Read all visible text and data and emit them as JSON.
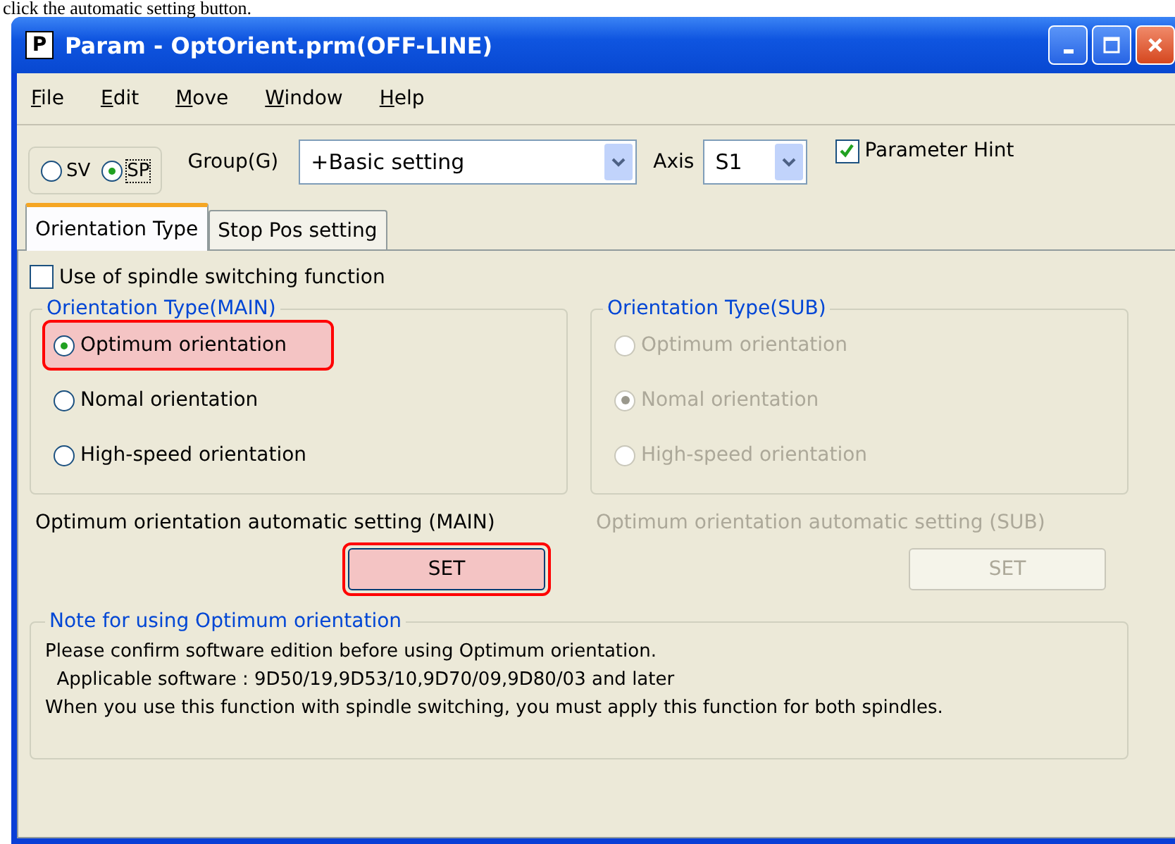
{
  "caption": "click the automatic setting button.",
  "window": {
    "icon": "P",
    "title": "Param - OptOrient.prm(OFF-LINE)"
  },
  "menu": [
    {
      "label": "File"
    },
    {
      "label": "Edit"
    },
    {
      "label": "Move"
    },
    {
      "label": "Window"
    },
    {
      "label": "Help"
    }
  ],
  "mode": [
    {
      "label": "SV",
      "selected": false
    },
    {
      "label": "SP",
      "selected": true
    }
  ],
  "group": {
    "label": "Group(G)",
    "value": "+Basic setting"
  },
  "axis": {
    "label": "Axis",
    "value": "S1"
  },
  "parameter_hint": {
    "label": "Parameter Hint",
    "checked": true
  },
  "tabs": [
    {
      "label": "Orientation Type",
      "selected": true
    },
    {
      "label": "Stop Pos setting",
      "selected": false
    }
  ],
  "spindle_switching": {
    "label": "Use of spindle switching function",
    "checked": false
  },
  "groups": [
    {
      "title": "Orientation Type(MAIN)",
      "disabled": false,
      "options": [
        {
          "label": "Optimum orientation",
          "selected": true,
          "highlighted": true
        },
        {
          "label": "Nomal orientation",
          "selected": false,
          "highlighted": false
        },
        {
          "label": "High-speed orientation",
          "selected": false,
          "highlighted": false
        }
      ],
      "auto_label": "Optimum orientation automatic setting (MAIN)",
      "button": {
        "label": "SET",
        "highlighted": true
      }
    },
    {
      "title": "Orientation Type(SUB)",
      "disabled": true,
      "options": [
        {
          "label": "Optimum orientation",
          "selected": false,
          "highlighted": false
        },
        {
          "label": "Nomal orientation",
          "selected": true,
          "highlighted": false
        },
        {
          "label": "High-speed orientation",
          "selected": false,
          "highlighted": false
        }
      ],
      "auto_label": "Optimum orientation automatic setting (SUB)",
      "button": {
        "label": "SET",
        "highlighted": false
      }
    }
  ],
  "note": {
    "title": "Note for using Optimum orientation",
    "lines": [
      "Please confirm software edition before using Optimum orientation.",
      "  Applicable software : 9D50/19,9D53/10,9D70/09,9D80/03 and later",
      "When you use this function with spindle switching, you must apply this function for both spindles."
    ]
  }
}
